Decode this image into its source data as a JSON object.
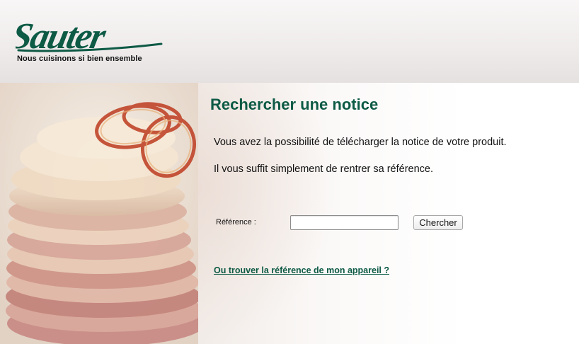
{
  "brand": {
    "logo_text": "Sauter",
    "tagline": "Nous cuisinons si bien ensemble",
    "logo_color": "#0d5a45"
  },
  "hero": {
    "image": "layered-potato-dish-photo"
  },
  "main": {
    "title": "Rechercher une notice",
    "paragraphs": [
      "Vous avez la possibilité de télécharger la notice de votre produit.",
      "Il vous suffit simplement de rentrer sa référence."
    ],
    "form": {
      "label": "Référence :",
      "input_value": "",
      "input_placeholder": "",
      "button_label": "Chercher"
    },
    "help_link": "Ou trouver la référence de mon appareil ?"
  },
  "colors": {
    "accent": "#0d5a45",
    "header_bg": "#efebeb"
  }
}
